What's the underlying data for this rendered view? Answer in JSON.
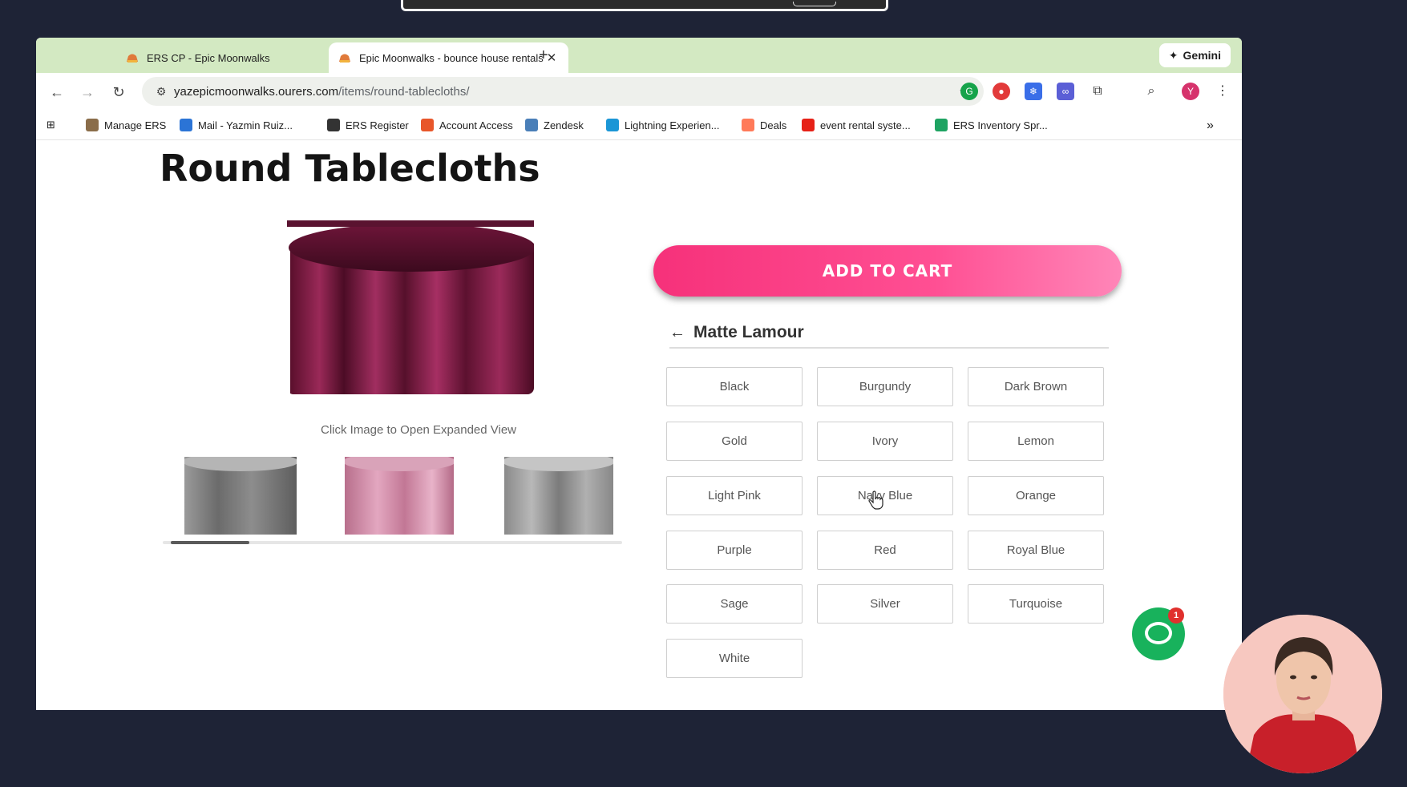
{
  "browser": {
    "tabs": [
      {
        "title": "ERS CP - Epic Moonwalks",
        "active": false
      },
      {
        "title": "Epic Moonwalks - bounce house rentals",
        "active": true
      }
    ],
    "new_tab_symbol": "+",
    "close_symbol": "✕",
    "gemini_label": "Gemini",
    "url_domain": "yazepicmoonwalks.ourers.com",
    "url_path": "/items/round-tablecloths/",
    "profile_initial": "Y",
    "bookmarks": [
      {
        "label": "Manage ERS",
        "icon": "ers-icon",
        "color": "#8a6d4a"
      },
      {
        "label": "Mail - Yazmin Ruiz...",
        "icon": "outlook-icon",
        "color": "#2b74d6"
      },
      {
        "label": "ERS Register",
        "icon": "globe-icon",
        "color": "#333333"
      },
      {
        "label": "Account Access",
        "icon": "account-icon",
        "color": "#e8562a"
      },
      {
        "label": "Zendesk",
        "icon": "zendesk-icon",
        "color": "#4a7fb8"
      },
      {
        "label": "Lightning Experien...",
        "icon": "salesforce-icon",
        "color": "#1b96d6"
      },
      {
        "label": "Deals",
        "icon": "hubspot-icon",
        "color": "#ff7a59"
      },
      {
        "label": "event rental syste...",
        "icon": "youtube-icon",
        "color": "#e62117"
      },
      {
        "label": "ERS Inventory Spr...",
        "icon": "sheets-icon",
        "color": "#1ea362"
      }
    ],
    "bookmarks_more": "»"
  },
  "page": {
    "title": "Round Tablecloths",
    "image_caption": "Click Image to Open Expanded View",
    "add_to_cart_label": "ADD TO CART",
    "variant_back_symbol": "←",
    "variant_name": "Matte Lamour",
    "colors": [
      "Black",
      "Burgundy",
      "Dark Brown",
      "Gold",
      "Ivory",
      "Lemon",
      "Light Pink",
      "Navy Blue",
      "Orange",
      "Purple",
      "Red",
      "Royal Blue",
      "Sage",
      "Silver",
      "Turquoise",
      "White"
    ],
    "chat_badge_count": "1"
  },
  "theme": {
    "tab_bar": "#d3e9c2",
    "accent_pink": "#f6317a",
    "chat_green": "#18b25c",
    "tablecloth_burgundy": "#8e1f4f"
  }
}
